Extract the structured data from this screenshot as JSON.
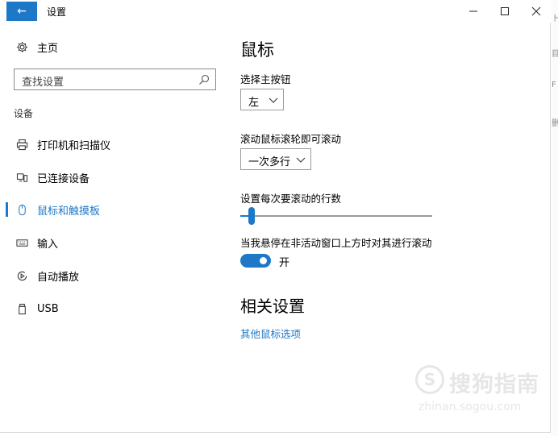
{
  "window": {
    "title": "设置",
    "back_glyph": "←",
    "controls": {
      "minimize": "–",
      "maximize": "□",
      "close": "✕"
    }
  },
  "sidebar": {
    "home": {
      "label": "主页",
      "icon": "gear-icon"
    },
    "search": {
      "placeholder": "查找设置",
      "icon": "search-icon"
    },
    "section_label": "设备",
    "items": [
      {
        "label": "打印机和扫描仪",
        "icon": "printer-icon",
        "selected": false
      },
      {
        "label": "已连接设备",
        "icon": "connected-devices-icon",
        "selected": false
      },
      {
        "label": "鼠标和触摸板",
        "icon": "mouse-icon",
        "selected": true
      },
      {
        "label": "输入",
        "icon": "keyboard-icon",
        "selected": false
      },
      {
        "label": "自动播放",
        "icon": "autoplay-icon",
        "selected": false
      },
      {
        "label": "USB",
        "icon": "usb-icon",
        "selected": false
      }
    ]
  },
  "main": {
    "title": "鼠标",
    "primary_button": {
      "label": "选择主按钮",
      "value": "左"
    },
    "scroll_mode": {
      "label": "滚动鼠标滚轮即可滚动",
      "value": "一次多行"
    },
    "scroll_lines": {
      "label": "设置每次要滚动的行数",
      "value_fraction": 0.06
    },
    "inactive_scroll": {
      "label": "当我悬停在非活动窗口上方时对其进行滚动",
      "state_label": "开",
      "on": true
    },
    "related_title": "相关设置",
    "related_link": "其他鼠标选项"
  },
  "colors": {
    "accent": "#1e78c8"
  },
  "watermark": {
    "logo_glyph": "S",
    "text": "搜狗指南",
    "url": "zhinan.sogou.com"
  },
  "background_window": {
    "glyphs": [
      "卜",
      "目",
      "F",
      "删"
    ]
  }
}
